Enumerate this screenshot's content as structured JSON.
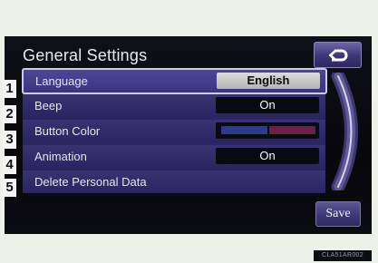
{
  "header": {
    "title": "General Settings"
  },
  "buttons": {
    "back_icon": "back-arrow-icon",
    "save_label": "Save"
  },
  "settings": [
    {
      "number": "1",
      "label": "Language",
      "value": "English",
      "selected": true
    },
    {
      "number": "2",
      "label": "Beep",
      "value": "On"
    },
    {
      "number": "3",
      "label": "Button Color",
      "value": "",
      "swatches": [
        "#2c3c8c",
        "#6a2048"
      ]
    },
    {
      "number": "4",
      "label": "Animation",
      "value": "On"
    },
    {
      "number": "5",
      "label": "Delete Personal Data",
      "value": ""
    }
  ],
  "figure_code": "CLA51AR002",
  "colors": {
    "accent": "#3b3480",
    "highlight_border": "#cfcbe6",
    "panel": "#2b2560"
  }
}
